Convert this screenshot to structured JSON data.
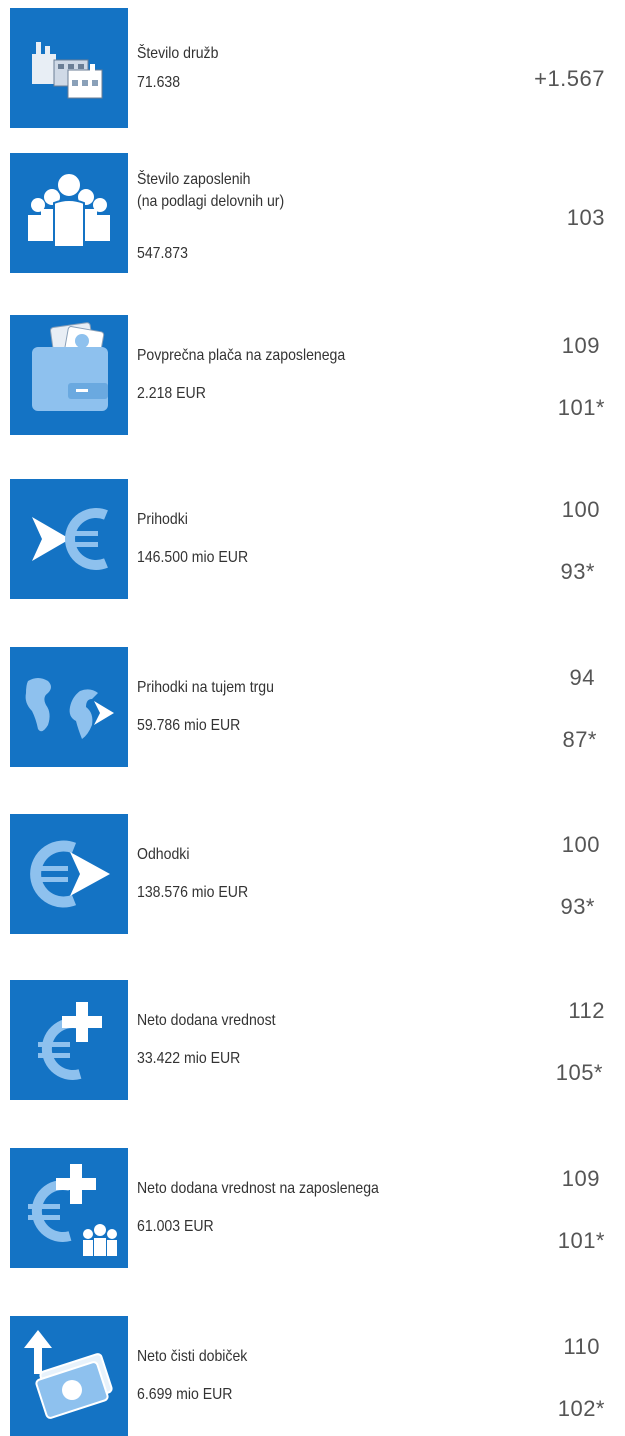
{
  "colors": {
    "tile": "#1473c4",
    "tile_light": "#8ec1ee",
    "text": "#333333"
  },
  "items": [
    {
      "icon": "factory-icon",
      "label": "Število družb",
      "value": "71.638",
      "index": "+1.567",
      "real_index": ""
    },
    {
      "icon": "people-icon",
      "label": "Število zaposlenih\n(na podlagi delovnih ur)",
      "value": "547.873",
      "index": "103",
      "real_index": ""
    },
    {
      "icon": "wallet-icon",
      "label": "Povprečna plača na zaposlenega",
      "value": "2.218 EUR",
      "index": "109",
      "real_index": "101*"
    },
    {
      "icon": "euro-arrow-in-icon",
      "label": "Prihodki",
      "value": "146.500 mio EUR",
      "index": "100",
      "real_index": "93*"
    },
    {
      "icon": "globe-arrow-icon",
      "label": "Prihodki na tujem trgu",
      "value": "59.786 mio EUR",
      "index": "94",
      "real_index": "87*"
    },
    {
      "icon": "euro-arrow-out-icon",
      "label": "Odhodki",
      "value": "138.576 mio EUR",
      "index": "100",
      "real_index": "93*"
    },
    {
      "icon": "euro-plus-icon",
      "label": "Neto dodana vrednost",
      "value": "33.422 mio EUR",
      "index": "112",
      "real_index": "105*"
    },
    {
      "icon": "euro-plus-people-icon",
      "label": "Neto dodana vrednost na zaposlenega",
      "value": "61.003 EUR",
      "index": "109",
      "real_index": "101*"
    },
    {
      "icon": "money-up-icon",
      "label": "Neto čisti dobiček",
      "value": "6.699 mio EUR",
      "index": "110",
      "real_index": "102*"
    }
  ]
}
